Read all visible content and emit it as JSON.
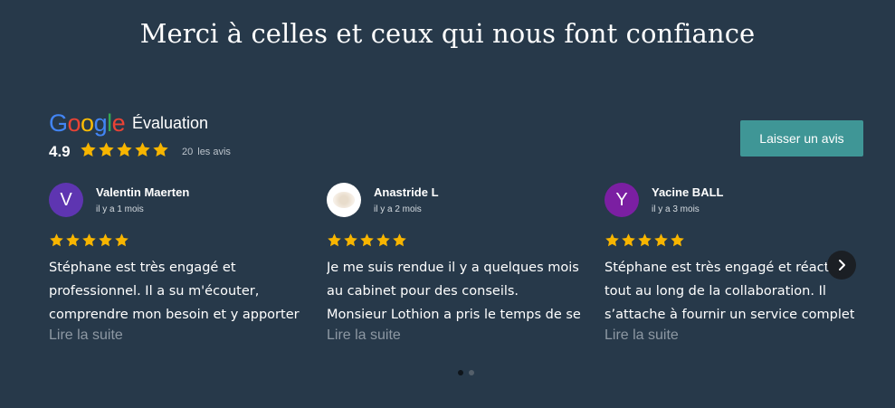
{
  "page": {
    "title": "Merci à celles et ceux qui nous font confiance"
  },
  "header": {
    "logo_letters": [
      {
        "ch": "G",
        "color": "#4285f4"
      },
      {
        "ch": "o",
        "color": "#ea4335"
      },
      {
        "ch": "o",
        "color": "#fbbc05"
      },
      {
        "ch": "g",
        "color": "#4285f4"
      },
      {
        "ch": "l",
        "color": "#34a853"
      },
      {
        "ch": "e",
        "color": "#ea4335"
      }
    ],
    "label": "Évaluation",
    "score": "4.9",
    "stars": 5,
    "count": "20",
    "count_label": "les avis",
    "button_label": "Laisser un avis"
  },
  "colors": {
    "background": "#27394a",
    "star": "#f7b500",
    "button": "#3f9696",
    "muted": "#8d98a3"
  },
  "reviews": [
    {
      "author": "Valentin Maerten",
      "date": "il y a 1 mois",
      "avatar_letter": "V",
      "avatar_color": "#5e35b1",
      "stars": 5,
      "lines": [
        "Stéphane est très engagé et",
        "professionnel. Il a su m'écouter,",
        "comprendre mon besoin et y apporter"
      ],
      "read_more": "Lire la suite"
    },
    {
      "author": "Anastride L",
      "date": "il y a 2 mois",
      "avatar_letter": "",
      "avatar_color": "#ffffff",
      "stars": 5,
      "lines": [
        "Je me suis rendue il y a quelques mois",
        "au cabinet pour des conseils.",
        "Monsieur Lothion a pris le temps de se"
      ],
      "read_more": "Lire la suite"
    },
    {
      "author": "Yacine BALL",
      "date": "il y a 3 mois",
      "avatar_letter": "Y",
      "avatar_color": "#7b1fa2",
      "stars": 5,
      "lines": [
        "Stéphane est très engagé et réactif",
        "tout au long de la collaboration. Il",
        "s’attache à fournir un service complet"
      ],
      "read_more": "Lire la suite"
    }
  ],
  "carousel": {
    "next_icon": "chevron-right-icon",
    "pages": 2,
    "active": 0
  }
}
